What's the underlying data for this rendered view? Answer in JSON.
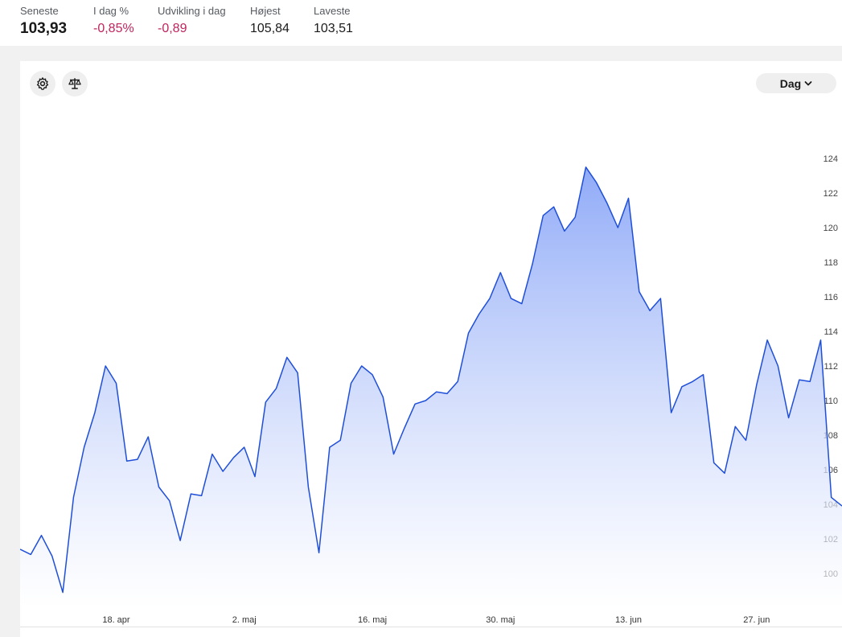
{
  "stats": {
    "latest": {
      "label": "Seneste",
      "value": "103,93"
    },
    "day_pct": {
      "label": "I dag %",
      "value": "-0,85%"
    },
    "day_change": {
      "label": "Udvikling i dag",
      "value": "-0,89"
    },
    "high": {
      "label": "Højest",
      "value": "105,84"
    },
    "low": {
      "label": "Laveste",
      "value": "103,51"
    }
  },
  "controls": {
    "period_label": "Dag",
    "settings_icon": "gear-icon",
    "compare_icon": "scale-icon",
    "period_icon": "chevron-down-icon"
  },
  "colors": {
    "line": "#1f4fd8",
    "fill_top": "#8aa6f7",
    "negative": "#c0245d"
  },
  "chart_data": {
    "type": "area",
    "y_ticks": [
      "100",
      "102",
      "104",
      "106",
      "108",
      "110",
      "112",
      "114",
      "116",
      "118",
      "120",
      "122",
      "124"
    ],
    "x_ticks": [
      "18. apr",
      "2. maj",
      "16. maj",
      "30. maj",
      "13. jun",
      "27. jun"
    ],
    "ylim": [
      98.6,
      124.8
    ],
    "grid": false,
    "series": [
      {
        "values": [
          101.4,
          101.1,
          102.2,
          101.0,
          98.9,
          104.4,
          107.3,
          109.3,
          112.0,
          111.0,
          106.5,
          106.6,
          107.9,
          105.0,
          104.2,
          101.9,
          104.6,
          104.5,
          106.9,
          105.9,
          106.7,
          107.3,
          105.6,
          109.9,
          110.7,
          112.5,
          111.6,
          105.0,
          101.2,
          107.3,
          107.7,
          111.0,
          112.0,
          111.5,
          110.2,
          106.9,
          108.4,
          109.8,
          110.0,
          110.5,
          110.4,
          111.1,
          113.9,
          115.0,
          115.9,
          117.4,
          115.9,
          115.6,
          117.9,
          120.7,
          121.2,
          119.8,
          120.6,
          123.5,
          122.6,
          121.4,
          120.0,
          121.7,
          116.3,
          115.2,
          115.9,
          109.3,
          110.8,
          111.1,
          111.5,
          106.4,
          105.8,
          108.5,
          107.7,
          110.9,
          113.5,
          112.0,
          109.0,
          111.2,
          111.1,
          113.5,
          104.4,
          103.9
        ]
      }
    ]
  }
}
